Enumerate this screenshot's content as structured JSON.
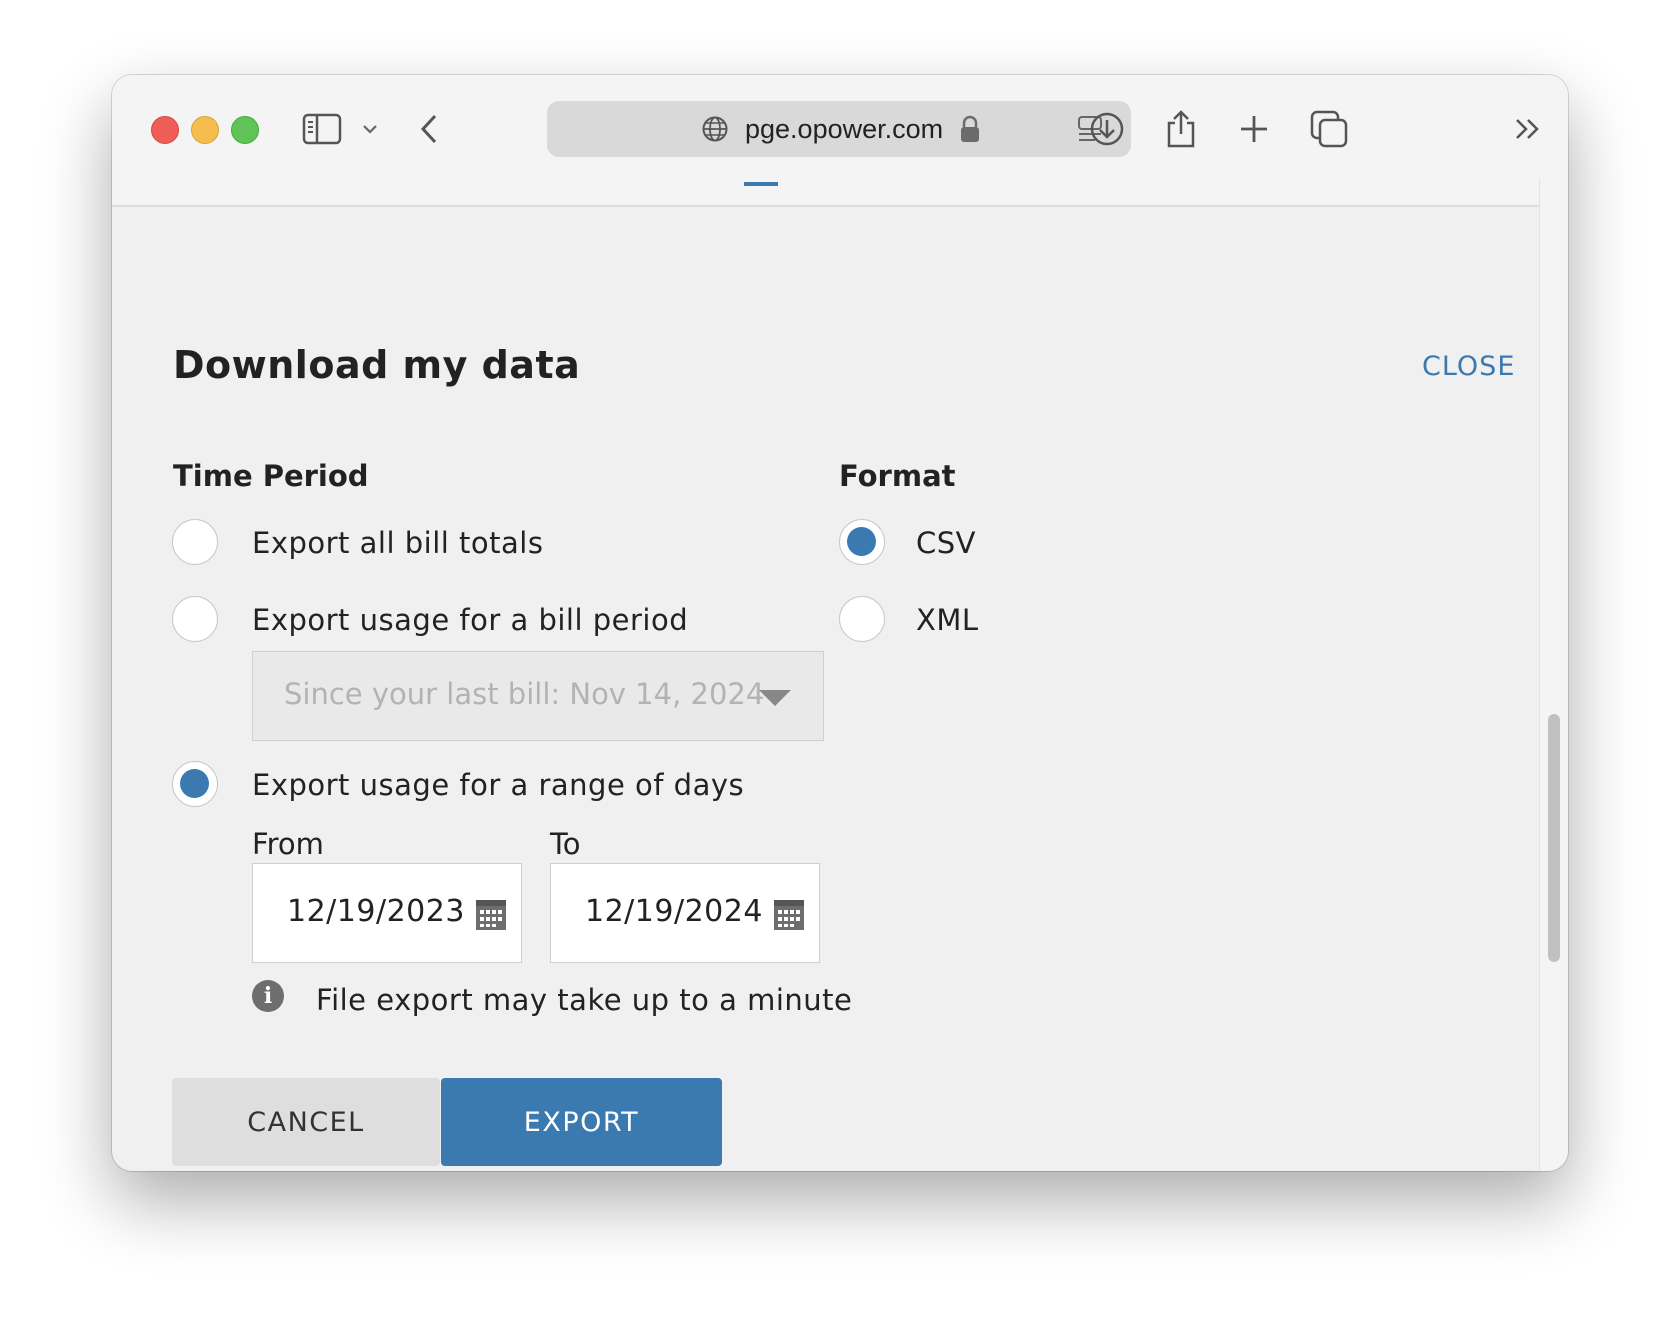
{
  "browser": {
    "url": "pge.opower.com",
    "icons": [
      "sidebar-icon",
      "chevron-down-icon",
      "back-icon",
      "globe-icon",
      "lock-icon",
      "reader-icon",
      "download-icon",
      "share-icon",
      "plus-icon",
      "tabs-icon",
      "more-icon"
    ]
  },
  "dialog": {
    "title": "Download my data",
    "close_label": "CLOSE",
    "time_period": {
      "heading": "Time Period",
      "options": [
        {
          "label": "Export all bill totals",
          "checked": false
        },
        {
          "label": "Export usage for a bill period",
          "checked": false
        },
        {
          "label": "Export usage for a range of days",
          "checked": true
        }
      ],
      "bill_period_select": "Since your last bill: Nov 14, 2024",
      "from_label": "From",
      "from_value": "12/19/2023",
      "to_label": "To",
      "to_value": "12/19/2024",
      "info": "File export may take up to a minute"
    },
    "format": {
      "heading": "Format",
      "options": [
        {
          "label": "CSV",
          "checked": true
        },
        {
          "label": "XML",
          "checked": false
        }
      ]
    },
    "cancel_label": "CANCEL",
    "export_label": "EXPORT"
  },
  "colors": {
    "accent": "#3a7ab0",
    "background": "#f0f0f0"
  }
}
